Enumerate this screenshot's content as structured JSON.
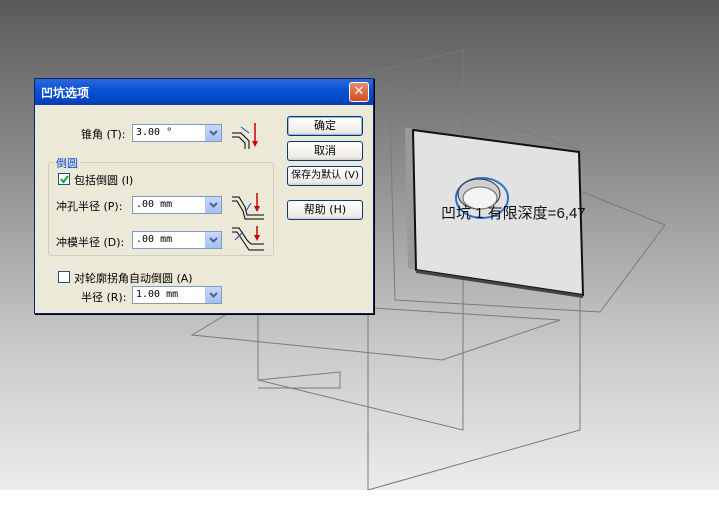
{
  "dialog": {
    "title": "凹坑选项",
    "cone_angle_label": "锥角 (T):",
    "cone_angle_value": "3.00 °",
    "fillet_group_title": "倒圆",
    "include_fillet_label": "包括倒圆 (I)",
    "include_fillet_checked": true,
    "punch_radius_label": "冲孔半径 (P):",
    "punch_radius_value": ".00 mm",
    "die_radius_label": "冲模半径 (D):",
    "die_radius_value": ".00 mm",
    "auto_round_label": "对轮廓拐角自动倒圆 (A)",
    "auto_round_checked": false,
    "radius_label": "半径 (R):",
    "radius_value": "1.00 mm",
    "buttons": {
      "ok": "确定",
      "cancel": "取消",
      "save_default": "保存为默认 (V)",
      "help": "帮助 (H)"
    }
  },
  "viewport": {
    "feature_label": "凹坑 1 有限深度=6,47"
  }
}
